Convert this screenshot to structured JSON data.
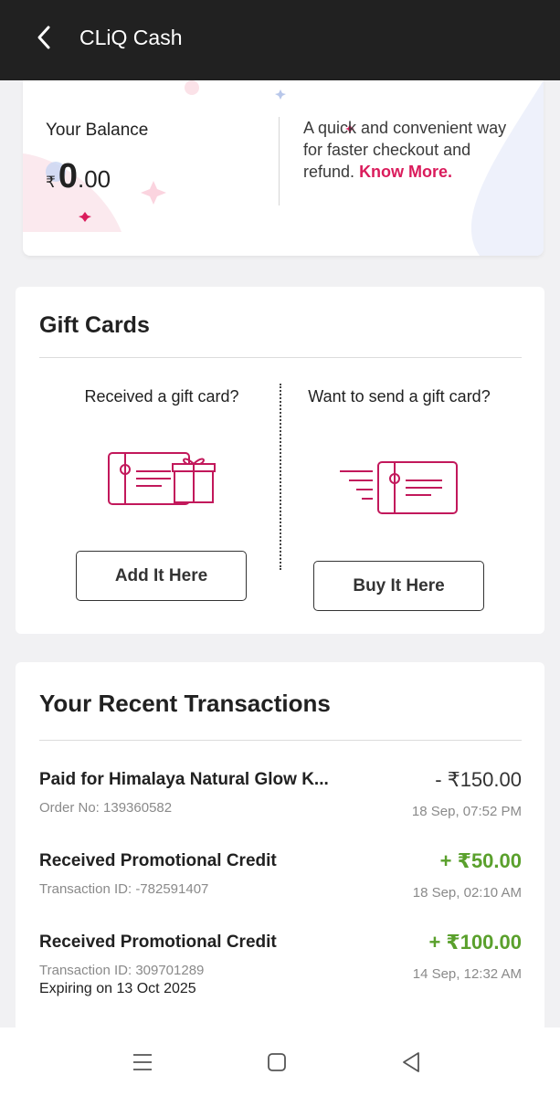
{
  "header": {
    "title": "CLiQ Cash"
  },
  "balance": {
    "label": "Your Balance",
    "currency_symbol": "₹",
    "amount_integer": "0",
    "amount_decimal": ".00",
    "description": "A quick and convenient way for faster checkout and refund.",
    "know_more_label": "Know More."
  },
  "gift_cards": {
    "title": "Gift Cards",
    "received_text": "Received a gift card?",
    "send_text": "Want to send a gift card?",
    "add_button_label": "Add It Here",
    "buy_button_label": "Buy It Here"
  },
  "transactions": {
    "title": "Your Recent Transactions",
    "items": [
      {
        "description": "Paid for Himalaya Natural Glow K...",
        "reference": "Order No: 139360582",
        "amount": "- ₹150.00",
        "date": "18 Sep, 07:52 PM",
        "type": "debit"
      },
      {
        "description": "Received Promotional Credit",
        "reference": "Transaction ID: -782591407",
        "amount": "+ ₹50.00",
        "date": "18 Sep, 02:10 AM",
        "type": "credit"
      },
      {
        "description": "Received Promotional Credit",
        "reference": "Transaction ID: 309701289",
        "expiry": "Expiring on 13 Oct 2025",
        "amount": "+ ₹100.00",
        "date": "14 Sep, 12:32 AM",
        "type": "credit"
      }
    ]
  },
  "colors": {
    "accent": "#da1c5c",
    "credit": "#5aa02c",
    "header_bg": "#212121"
  },
  "icons": {
    "back": "back-arrow-icon",
    "received_gift": "gift-card-with-box-icon",
    "send_gift": "sending-gift-card-icon",
    "nav_menu": "menu-icon",
    "nav_home": "home-icon",
    "nav_back": "back-triangle-icon"
  }
}
